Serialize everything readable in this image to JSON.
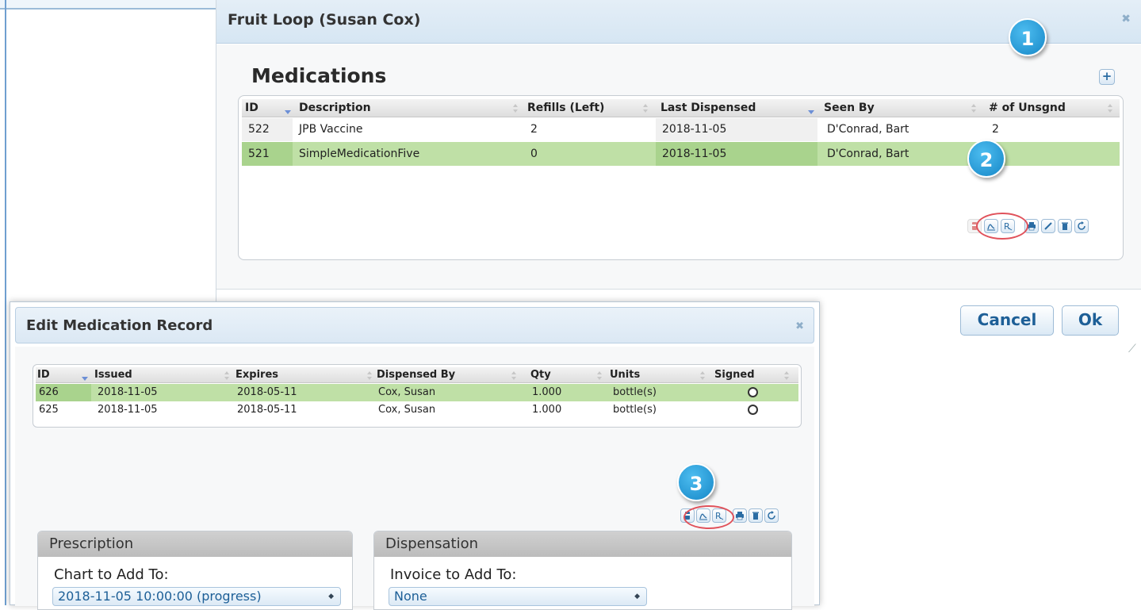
{
  "main_dialog": {
    "title": "Fruit Loop (Susan Cox)",
    "close_icon": "close-icon",
    "section_title": "Medications",
    "add_icon": "+",
    "table": {
      "columns": [
        "ID",
        "Description",
        "Refills (Left)",
        "Last Dispensed",
        "Seen By",
        "# of Unsgnd"
      ],
      "rows": [
        {
          "id": "522",
          "description": "JPB Vaccine",
          "refills": "2",
          "last_dispensed": "2018-11-05",
          "seen_by": "D'Conrad, Bart",
          "unsigned": "2",
          "selected": false
        },
        {
          "id": "521",
          "description": "SimpleMedicationFive",
          "refills": "0",
          "last_dispensed": "2018-11-05",
          "seen_by": "D'Conrad, Bart",
          "unsigned": "",
          "selected": true
        }
      ]
    },
    "toolbar_icons": [
      "dispense-icon",
      "sign-icon",
      "prescription-icon",
      "print-icon",
      "edit-icon",
      "delete-icon",
      "refresh-icon"
    ],
    "cancel_label": "Cancel",
    "ok_label": "Ok"
  },
  "edit_dialog": {
    "title": "Edit Medication Record",
    "close_icon": "close-icon",
    "table": {
      "columns": [
        "ID",
        "Issued",
        "Expires",
        "Dispensed By",
        "Qty",
        "Units",
        "Signed"
      ],
      "rows": [
        {
          "id": "626",
          "issued": "2018-11-05",
          "expires": "2018-05-11",
          "dispensed_by": "Cox, Susan",
          "qty": "1.000",
          "units": "bottle(s)",
          "signed": false,
          "selected": true
        },
        {
          "id": "625",
          "issued": "2018-11-05",
          "expires": "2018-05-11",
          "dispensed_by": "Cox, Susan",
          "qty": "1.000",
          "units": "bottle(s)",
          "signed": false,
          "selected": false
        }
      ]
    },
    "toolbar_icons": [
      "dispense-icon",
      "sign-icon",
      "prescription-icon",
      "print-icon",
      "delete-icon",
      "refresh-icon"
    ],
    "prescription": {
      "heading": "Prescription",
      "label": "Chart to Add To:",
      "value": "2018-11-05 10:00:00 (progress)"
    },
    "dispensation": {
      "heading": "Dispensation",
      "label": "Invoice to Add To:",
      "value": "None"
    }
  },
  "markers": [
    "1",
    "2",
    "3"
  ],
  "colors": {
    "selected_row": "#bfe0a6",
    "marker": "#1e90d0",
    "highlight_oval": "#e0525b",
    "button_text": "#1d5f97"
  }
}
